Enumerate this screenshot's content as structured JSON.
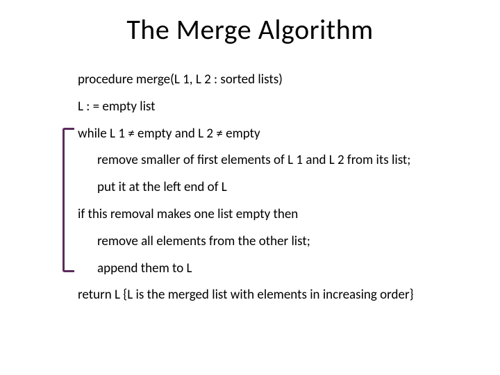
{
  "slide": {
    "title": "The Merge Algorithm",
    "lines": {
      "proc": "procedure merge(L 1, L 2 : sorted lists)",
      "init": "L : = empty list",
      "while": "while L 1 ≠ empty and L 2 ≠ empty",
      "remove_smaller": "remove smaller of first elements of L 1 and L 2 from its list;",
      "put_left": "put it at the left end of L",
      "if_empty": "if this removal makes one list empty then",
      "remove_all": "remove all elements from the other list;",
      "append": "append them to L",
      "return": "return L {L is the merged list with elements in increasing order}"
    }
  }
}
